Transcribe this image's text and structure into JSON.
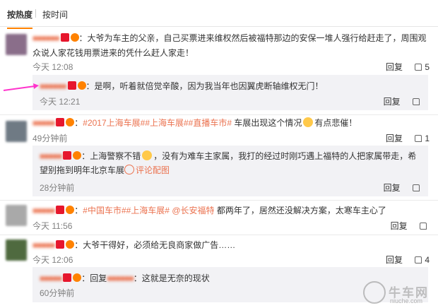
{
  "sort": {
    "hot": "按热度",
    "time": "按时间"
  },
  "colors": {
    "accent": "#ff8200",
    "link": "#eb7350",
    "reply_bg": "#f2f2f5"
  },
  "comments": [
    {
      "user": "■■■■■■",
      "text": "：大爷为车主的父亲，自己买票进来维权然后被福特那边的安保一堆人强行给赶走了，周围观众说人家花钱用票进来的凭什么赶人家走！",
      "time": "今天 12:08",
      "reply": "回复",
      "likes": "5",
      "replies": [
        {
          "user": "■■■■■■",
          "text": "：是啊，听着就倍觉辛酸，因为我当年也因翼虎断轴维权无门！",
          "time": "今天 12:21",
          "reply": "回复",
          "likes": ""
        }
      ]
    },
    {
      "user": "■■■■■",
      "tags": [
        "#2017上海车展#",
        "#上海车展#",
        "#直播车市#"
      ],
      "text_after": " 车展出现这个情况",
      "text_end": "有点悲催！",
      "time": "49分钟前",
      "reply": "回复",
      "likes": "1",
      "replies": [
        {
          "user": "■■■■■",
          "text_a": "：上海警察不错",
          "text_b": "，没有为难车主家属，我打的经过时刚巧遇上福特的人把家属带走，希望别拖到明年北京车展",
          "view_pic": "评论配图",
          "time": "28分钟前",
          "reply": "回复",
          "likes": ""
        }
      ]
    },
    {
      "user": "■■■■■",
      "tags": [
        "#中国车市#",
        "#上海车展#"
      ],
      "mention": "@长安福特",
      "text_after": " 都两年了，居然还没解决方案，太寒车主心了",
      "time": "今天 11:56",
      "reply": "回复",
      "likes": ""
    },
    {
      "user": "■■■■■",
      "text": "：大爷干得好，必须给无良商家做广告……",
      "time": "今天 12:06",
      "reply": "回复",
      "likes": "4",
      "replies": [
        {
          "user": "■■■■■",
          "text_a": "：回复",
          "mention": "■■■■■■",
          "text_b": "：这就是无奈的现状",
          "time": "60分钟前",
          "reply": "回复",
          "likes": ""
        }
      ]
    }
  ],
  "watermark": {
    "name": "牛车网",
    "url": "niuche.com"
  }
}
